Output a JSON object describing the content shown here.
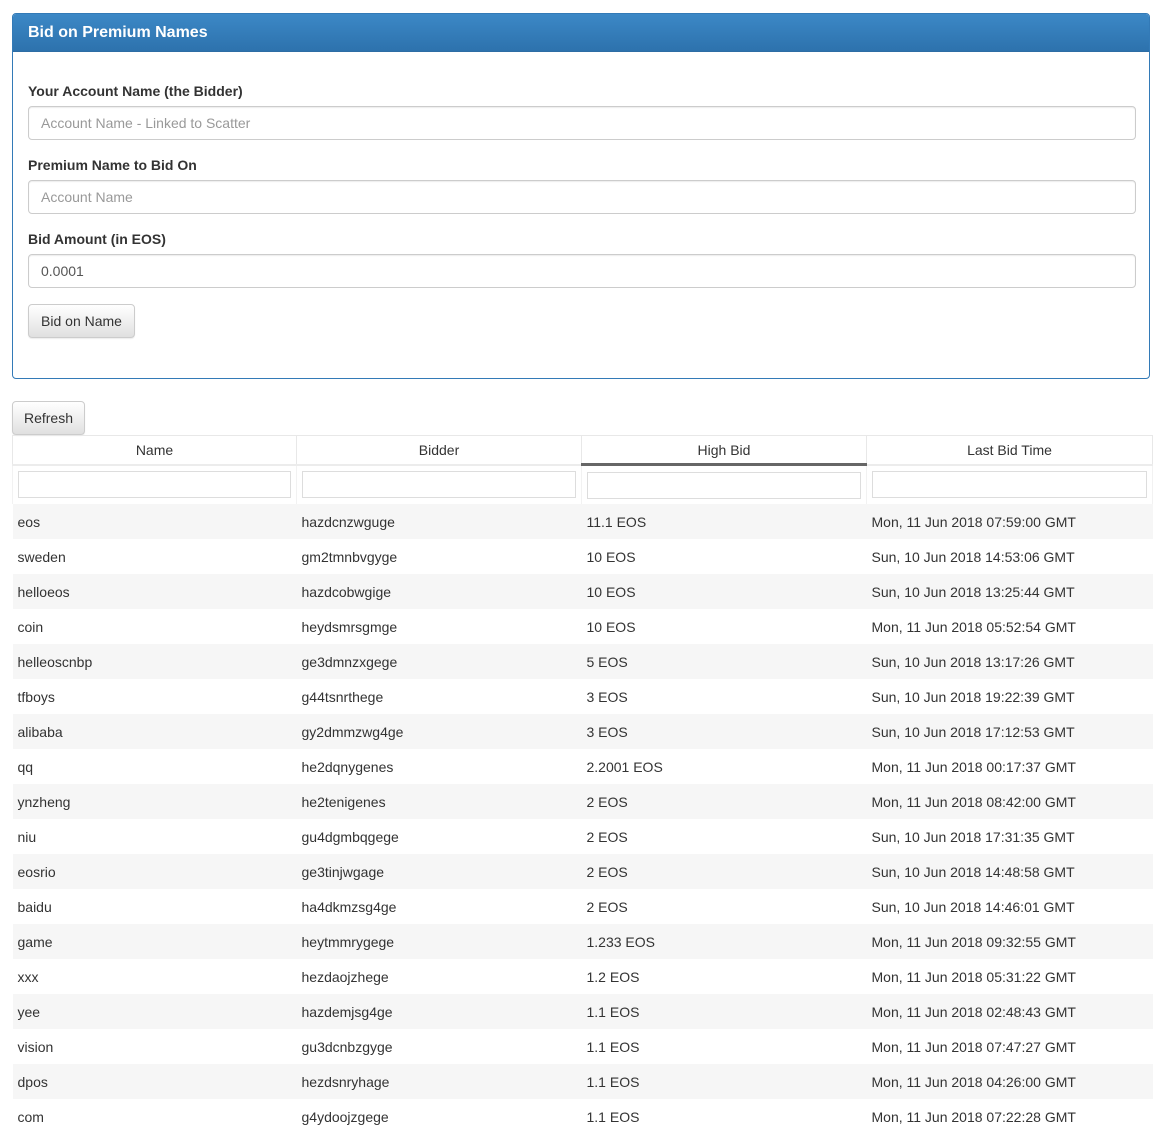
{
  "panel": {
    "title": "Bid on Premium Names",
    "account_label": "Your Account Name (the Bidder)",
    "account_placeholder": "Account Name - Linked to Scatter",
    "premium_label": "Premium Name to Bid On",
    "premium_placeholder": "Account Name",
    "amount_label": "Bid Amount (in EOS)",
    "amount_value": "0.0001",
    "bid_button": "Bid on Name"
  },
  "refresh_button": "Refresh",
  "table": {
    "columns": [
      "Name",
      "Bidder",
      "High Bid",
      "Last Bid Time"
    ],
    "sorted_column": "High Bid",
    "rows": [
      {
        "name": "eos",
        "bidder": "hazdcnzwguge",
        "high_bid": "11.1 EOS",
        "last_bid_time": "Mon, 11 Jun 2018 07:59:00 GMT"
      },
      {
        "name": "sweden",
        "bidder": "gm2tmnbvgyge",
        "high_bid": "10 EOS",
        "last_bid_time": "Sun, 10 Jun 2018 14:53:06 GMT"
      },
      {
        "name": "helloeos",
        "bidder": "hazdcobwgige",
        "high_bid": "10 EOS",
        "last_bid_time": "Sun, 10 Jun 2018 13:25:44 GMT"
      },
      {
        "name": "coin",
        "bidder": "heydsmrsgmge",
        "high_bid": "10 EOS",
        "last_bid_time": "Mon, 11 Jun 2018 05:52:54 GMT"
      },
      {
        "name": "helleoscnbp",
        "bidder": "ge3dmnzxgege",
        "high_bid": "5 EOS",
        "last_bid_time": "Sun, 10 Jun 2018 13:17:26 GMT"
      },
      {
        "name": "tfboys",
        "bidder": "g44tsnrthege",
        "high_bid": "3 EOS",
        "last_bid_time": "Sun, 10 Jun 2018 19:22:39 GMT"
      },
      {
        "name": "alibaba",
        "bidder": "gy2dmmzwg4ge",
        "high_bid": "3 EOS",
        "last_bid_time": "Sun, 10 Jun 2018 17:12:53 GMT"
      },
      {
        "name": "qq",
        "bidder": "he2dqnygenes",
        "high_bid": "2.2001 EOS",
        "last_bid_time": "Mon, 11 Jun 2018 00:17:37 GMT"
      },
      {
        "name": "ynzheng",
        "bidder": "he2tenigenes",
        "high_bid": "2 EOS",
        "last_bid_time": "Mon, 11 Jun 2018 08:42:00 GMT"
      },
      {
        "name": "niu",
        "bidder": "gu4dgmbqgege",
        "high_bid": "2 EOS",
        "last_bid_time": "Sun, 10 Jun 2018 17:31:35 GMT"
      },
      {
        "name": "eosrio",
        "bidder": "ge3tinjwgage",
        "high_bid": "2 EOS",
        "last_bid_time": "Sun, 10 Jun 2018 14:48:58 GMT"
      },
      {
        "name": "baidu",
        "bidder": "ha4dkmzsg4ge",
        "high_bid": "2 EOS",
        "last_bid_time": "Sun, 10 Jun 2018 14:46:01 GMT"
      },
      {
        "name": "game",
        "bidder": "heytmmrygege",
        "high_bid": "1.233 EOS",
        "last_bid_time": "Mon, 11 Jun 2018 09:32:55 GMT"
      },
      {
        "name": "xxx",
        "bidder": "hezdaojzhege",
        "high_bid": "1.2 EOS",
        "last_bid_time": "Mon, 11 Jun 2018 05:31:22 GMT"
      },
      {
        "name": "yee",
        "bidder": "hazdemjsg4ge",
        "high_bid": "1.1 EOS",
        "last_bid_time": "Mon, 11 Jun 2018 02:48:43 GMT"
      },
      {
        "name": "vision",
        "bidder": "gu3dcnbzgyge",
        "high_bid": "1.1 EOS",
        "last_bid_time": "Mon, 11 Jun 2018 07:47:27 GMT"
      },
      {
        "name": "dpos",
        "bidder": "hezdsnryhage",
        "high_bid": "1.1 EOS",
        "last_bid_time": "Mon, 11 Jun 2018 04:26:00 GMT"
      },
      {
        "name": "com",
        "bidder": "g4ydoojzgege",
        "high_bid": "1.1 EOS",
        "last_bid_time": "Mon, 11 Jun 2018 07:22:28 GMT"
      }
    ]
  },
  "colors": {
    "panel_header": "#337ab7",
    "row_stripe": "#f6f6f6"
  }
}
